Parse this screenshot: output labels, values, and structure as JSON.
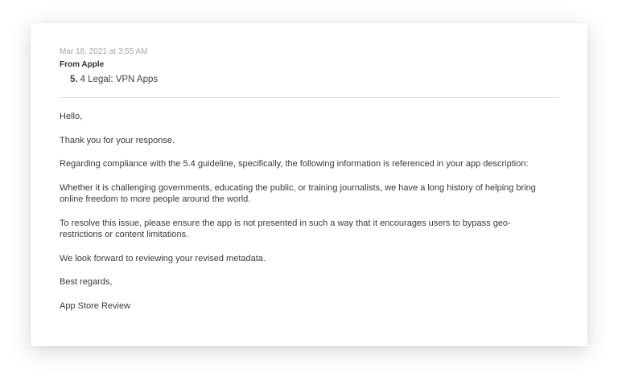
{
  "email": {
    "date": "Mar 18, 2021 at 3:55 AM",
    "from": "From Apple",
    "subject_number": "5.",
    "subject_text": "4 Legal: VPN Apps",
    "paragraphs": [
      "Hello,",
      "Thank you for your response.",
      "Regarding compliance with the 5.4 guideline, specifically, the following information is referenced in your app description:",
      "Whether it is challenging governments, educating the public, or training journalists, we have a long history of helping bring online freedom to more people around the world.",
      "To resolve this issue, please ensure the app is not presented in such a way that it encourages users to bypass geo-restrictions or content limitations.",
      "We look forward to reviewing your revised metadata.",
      "Best regards,",
      "App Store Review"
    ]
  },
  "colors": {
    "background": "#ffffff",
    "card": "#ffffff",
    "muted_text": "#a6a6a6",
    "body_text": "#3a3a3a",
    "divider": "#dcdcdc"
  }
}
